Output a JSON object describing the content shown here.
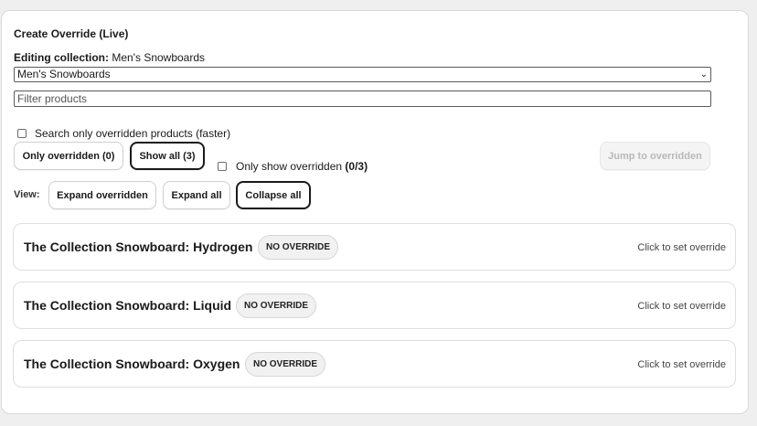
{
  "header": {
    "title": "Create Override (Live)",
    "editing_label": "Editing collection:",
    "editing_value": "Men's Snowboards"
  },
  "collection_select": {
    "selected": "Men's Snowboards"
  },
  "filter": {
    "placeholder": "Filter products",
    "value": ""
  },
  "search_overridden": {
    "label": "Search only overridden products (faster)",
    "checked": false
  },
  "filter_buttons": {
    "only_overridden": "Only overridden (0)",
    "show_all": "Show all (3)",
    "only_show_label": "Only show overridden",
    "only_show_count": "(0/3)",
    "jump": "Jump to overridden"
  },
  "view": {
    "label": "View:",
    "expand_overridden": "Expand overridden",
    "expand_all": "Expand all",
    "collapse_all": "Collapse all"
  },
  "products": [
    {
      "name": "The Collection Snowboard: Hydrogen",
      "badge": "NO OVERRIDE",
      "hint": "Click to set override"
    },
    {
      "name": "The Collection Snowboard: Liquid",
      "badge": "NO OVERRIDE",
      "hint": "Click to set override"
    },
    {
      "name": "The Collection Snowboard: Oxygen",
      "badge": "NO OVERRIDE",
      "hint": "Click to set override"
    }
  ],
  "colors": {
    "accent": "#1a1a1a",
    "card_bg": "#ffffff",
    "page_bg": "#efefef",
    "badge_bg": "#f1f1f1"
  }
}
